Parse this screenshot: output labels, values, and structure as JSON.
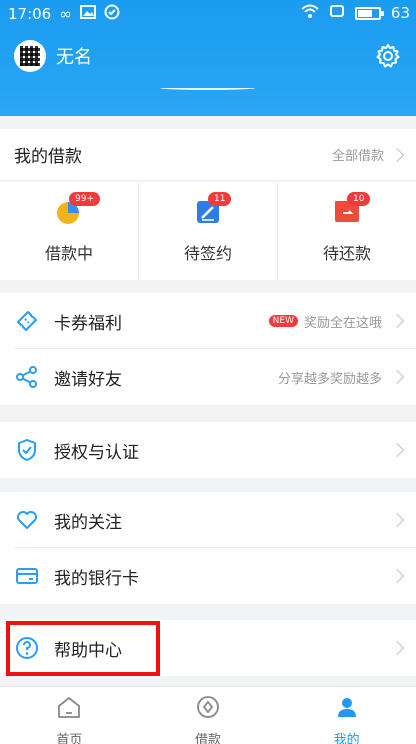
{
  "status_bar": {
    "time": "17:06",
    "battery": "63",
    "battery_level": 0.63
  },
  "header": {
    "username": "无名",
    "avatar_icon": "qr-avatar-icon",
    "settings_icon": "gear-icon"
  },
  "my_loans": {
    "title": "我的借款",
    "all_link": "全部借款",
    "items": [
      {
        "label": "借款中",
        "badge": "99+",
        "icon": "loan-in-progress-icon",
        "color": "#f6b21a"
      },
      {
        "label": "待签约",
        "badge": "11",
        "icon": "sign-pen-icon",
        "color": "#2f7be8"
      },
      {
        "label": "待还款",
        "badge": "10",
        "icon": "repay-wallet-icon",
        "color": "#ee4b3b"
      }
    ]
  },
  "group1": [
    {
      "label": "卡券福利",
      "tag": "NEW",
      "extra": "奖励全在这哦",
      "icon": "coupon-icon"
    },
    {
      "label": "邀请好友",
      "extra": "分享越多奖励越多",
      "icon": "share-icon"
    }
  ],
  "group2": [
    {
      "label": "授权与认证",
      "icon": "shield-check-icon"
    }
  ],
  "group3": [
    {
      "label": "我的关注",
      "icon": "heart-icon"
    },
    {
      "label": "我的银行卡",
      "icon": "bank-card-icon"
    }
  ],
  "group4": [
    {
      "label": "帮助中心",
      "icon": "help-question-icon"
    }
  ],
  "tabbar": [
    {
      "label": "首页",
      "icon": "home-icon",
      "active": false
    },
    {
      "label": "借款",
      "icon": "loan-compass-icon",
      "active": false
    },
    {
      "label": "我的",
      "icon": "user-icon",
      "active": true
    }
  ],
  "accent_color": "#1a9cf0",
  "highlight_color": "#e11111"
}
